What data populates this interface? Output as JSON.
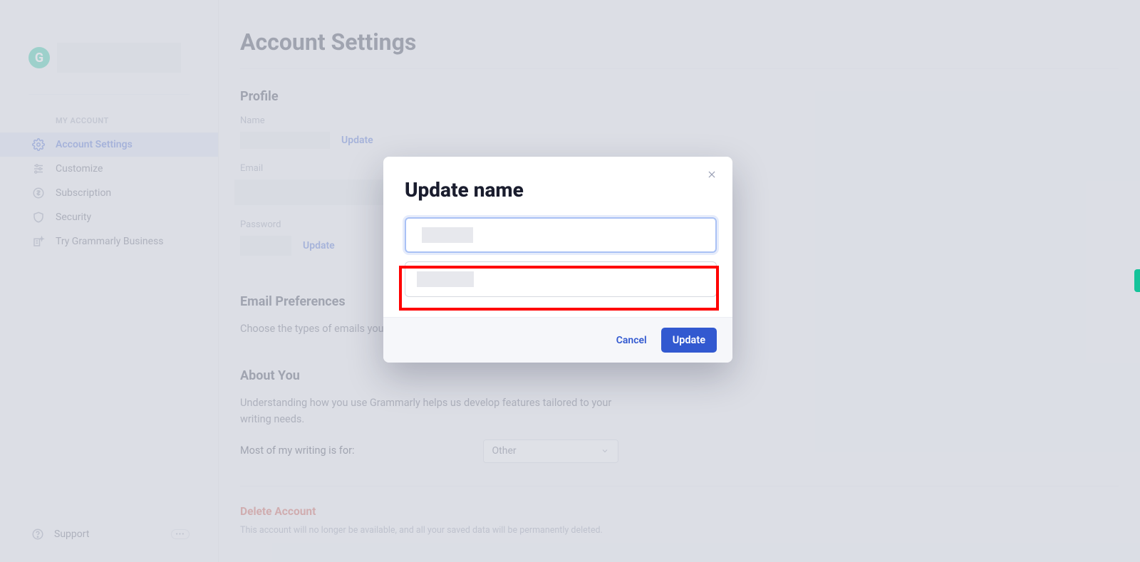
{
  "sidebar": {
    "section_label": "MY ACCOUNT",
    "items": [
      {
        "label": "Account Settings"
      },
      {
        "label": "Customize"
      },
      {
        "label": "Subscription"
      },
      {
        "label": "Security"
      },
      {
        "label": "Try Grammarly Business"
      }
    ],
    "support_label": "Support"
  },
  "page": {
    "title": "Account Settings",
    "profile": {
      "heading": "Profile",
      "name_label": "Name",
      "name_update": "Update",
      "email_label": "Email",
      "password_label": "Password",
      "password_update": "Update"
    },
    "email_prefs": {
      "heading": "Email Preferences",
      "body": "Choose the types of emails you"
    },
    "about": {
      "heading": "About You",
      "body": "Understanding how you use Grammarly helps us develop features tailored to your writing needs.",
      "writing_label": "Most of my writing is for:",
      "writing_value": "Other"
    },
    "delete": {
      "heading": "Delete Account",
      "body": "This account will no longer be available, and all your saved data will be permanently deleted."
    }
  },
  "modal": {
    "title": "Update name",
    "cancel": "Cancel",
    "update": "Update"
  }
}
